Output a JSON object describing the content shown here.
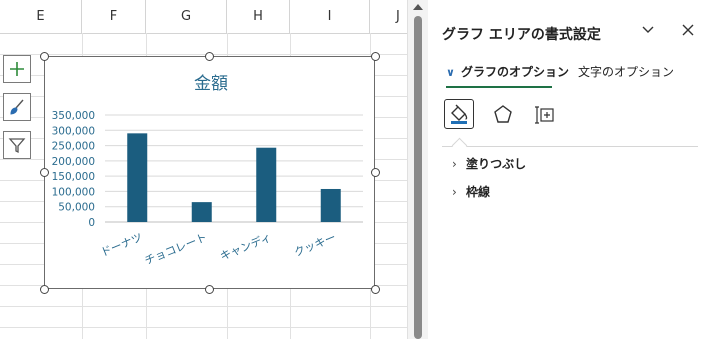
{
  "sheet": {
    "columns": [
      "E",
      "F",
      "G",
      "H",
      "I",
      "J"
    ]
  },
  "chart_buttons": [
    {
      "name": "chart-elements-icon"
    },
    {
      "name": "chart-styles-icon"
    },
    {
      "name": "chart-filters-icon"
    }
  ],
  "chart_data": {
    "type": "bar",
    "title": "金額",
    "categories": [
      "ドーナツ",
      "チョコレート",
      "キャンディ",
      "クッキー"
    ],
    "values": [
      290000,
      65000,
      243000,
      108000
    ],
    "ylim": [
      0,
      350000
    ],
    "yticks": [
      "350,000",
      "300,000",
      "250,000",
      "200,000",
      "150,000",
      "100,000",
      "50,000",
      "0"
    ],
    "bar_color": "#1b5d7f",
    "grid": true
  },
  "pane": {
    "title": "グラフ エリアの書式設定",
    "collapse_icon": "chevron-down-icon",
    "close_icon": "close-icon",
    "tab_graph": "グラフのオプション",
    "tab_text": "文字のオプション",
    "sections": [
      "塗りつぶし",
      "枠線"
    ]
  },
  "colors": {
    "accent_underline": "#1e7145",
    "chart_text": "#2b6c8f"
  }
}
